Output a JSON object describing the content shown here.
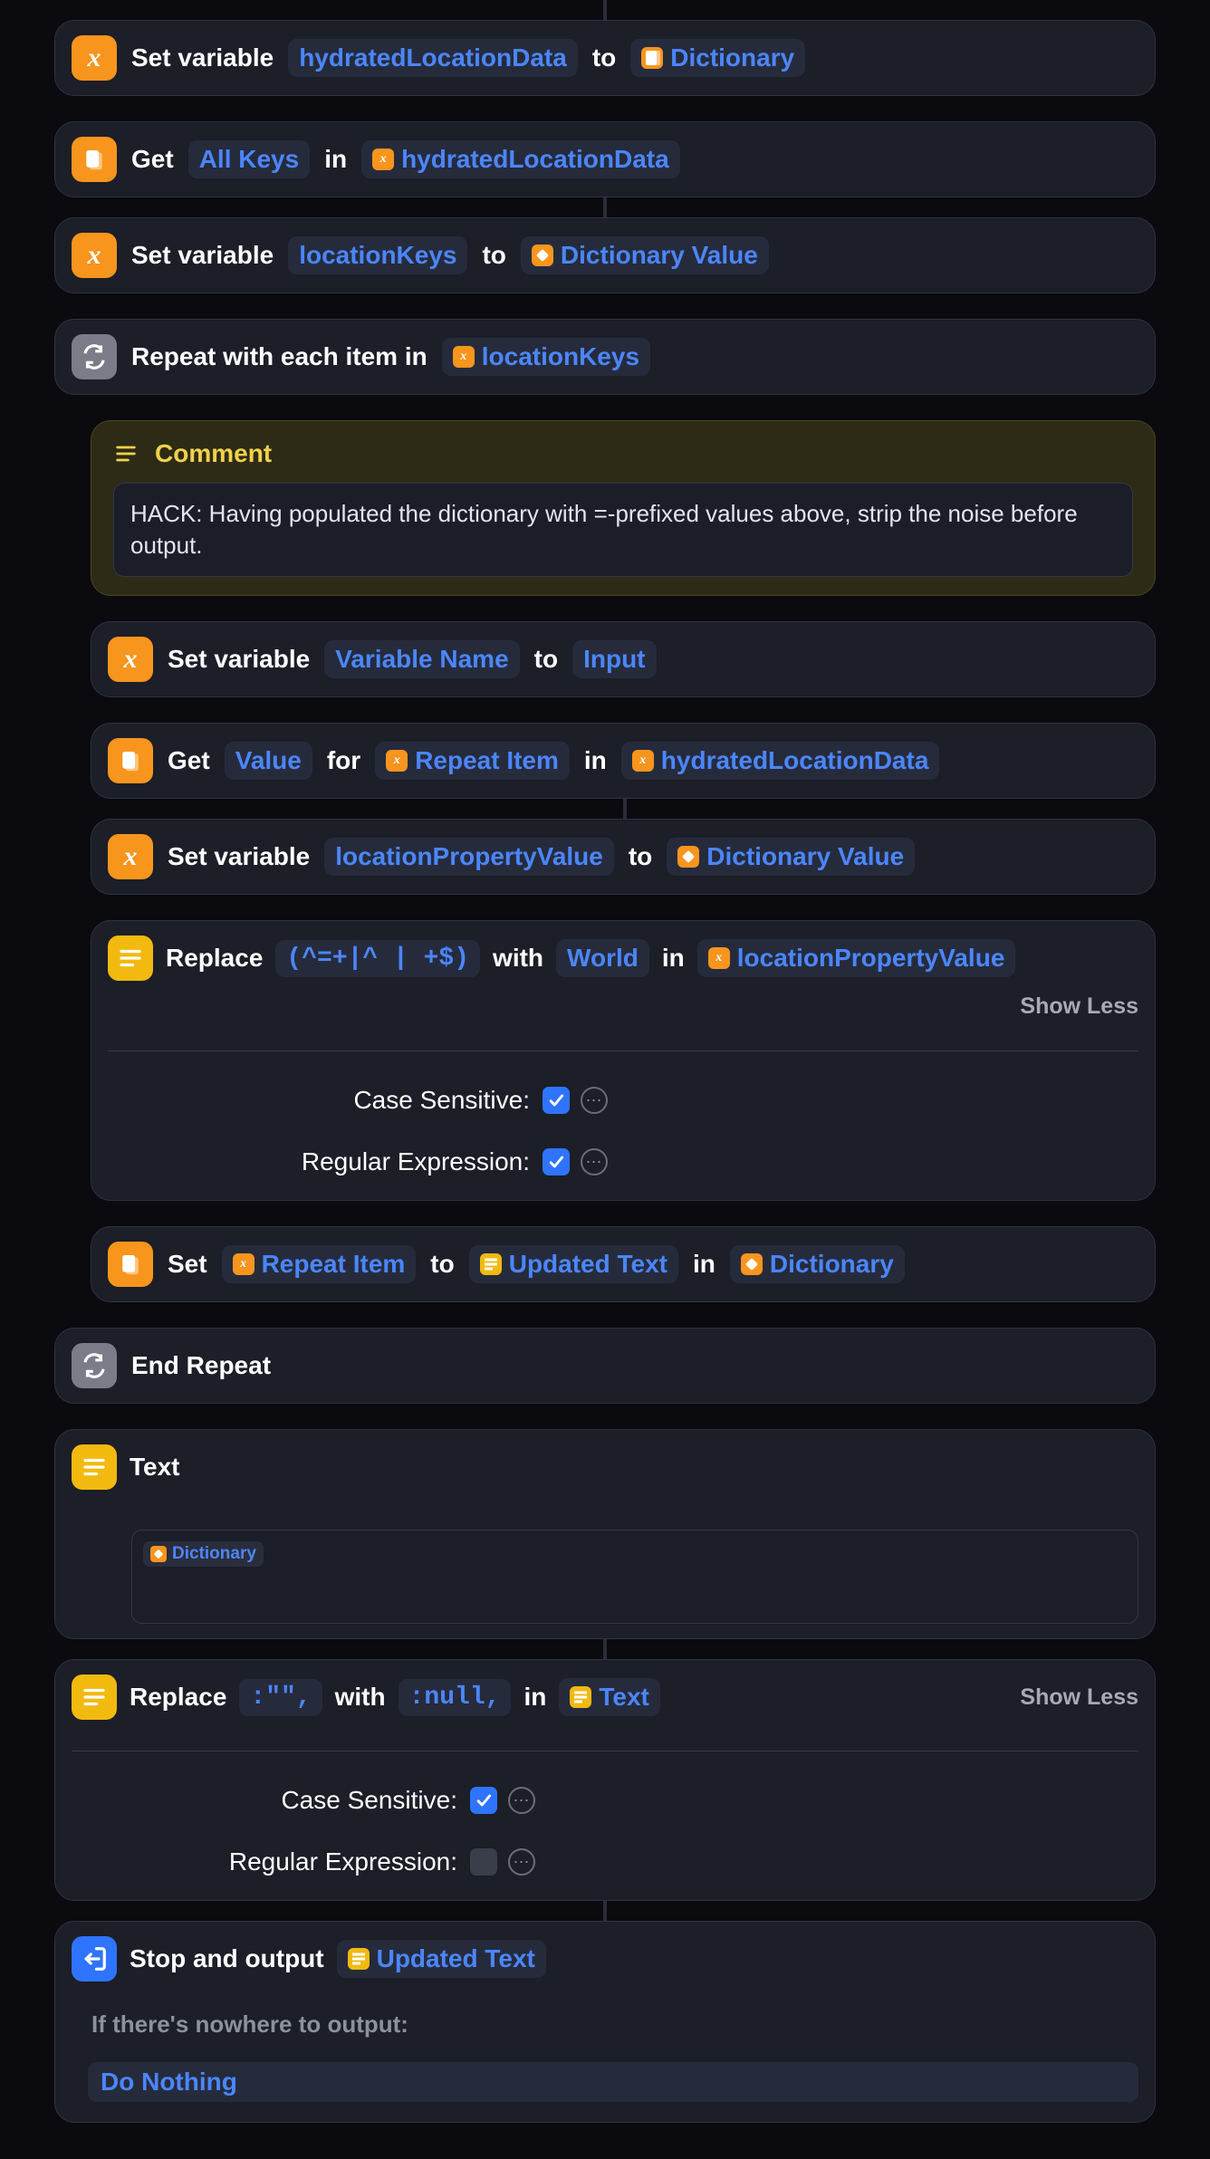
{
  "actions": {
    "a1": {
      "verb": "Set variable",
      "var": "hydratedLocationData",
      "to": "to",
      "valueIcon": "dict",
      "value": "Dictionary"
    },
    "a2": {
      "verb": "Get",
      "what": "All Keys",
      "in": "in",
      "fromVar": "hydratedLocationData"
    },
    "a3": {
      "verb": "Set variable",
      "var": "locationKeys",
      "to": "to",
      "valueIcon": "magic",
      "value": "Dictionary Value"
    },
    "a4": {
      "verb": "Repeat with each item in",
      "var": "locationKeys"
    },
    "comment": {
      "title": "Comment",
      "body": "HACK: Having populated the dictionary with =-prefixed values above, strip the noise before output."
    },
    "a5": {
      "verb": "Set variable",
      "var": "Variable Name",
      "to": "to",
      "value": "Input"
    },
    "a6": {
      "verb": "Get",
      "what": "Value",
      "for": "for",
      "itemVar": "Repeat Item",
      "in": "in",
      "fromVar": "hydratedLocationData"
    },
    "a7": {
      "verb": "Set variable",
      "var": "locationPropertyValue",
      "to": "to",
      "valueIcon": "magic",
      "value": "Dictionary Value"
    },
    "a8": {
      "verb": "Replace",
      "pattern": "(^=+|^ | +$)",
      "with": "with",
      "replacement": "World",
      "in": "in",
      "inVar": "locationPropertyValue",
      "showless": "Show Less",
      "opt1": "Case Sensitive:",
      "opt2": "Regular Expression:",
      "opt1_checked": true,
      "opt2_checked": true
    },
    "a9": {
      "verb": "Set",
      "keyVar": "Repeat Item",
      "to": "to",
      "valueVar": "Updated Text",
      "in": "in",
      "dest": "Dictionary"
    },
    "a10": {
      "verb": "End Repeat"
    },
    "a11": {
      "verb": "Text",
      "content": "Dictionary"
    },
    "a12": {
      "verb": "Replace",
      "pattern": ":\"\",",
      "with": "with",
      "replacement": ":null,",
      "in": "in",
      "inVar": "Text",
      "showless": "Show Less",
      "opt1": "Case Sensitive:",
      "opt2": "Regular Expression:",
      "opt1_checked": true,
      "opt2_checked": false
    },
    "a13": {
      "verb": "Stop and output",
      "outVar": "Updated Text",
      "footer": "If there's nowhere to output:",
      "fallback": "Do Nothing"
    }
  }
}
